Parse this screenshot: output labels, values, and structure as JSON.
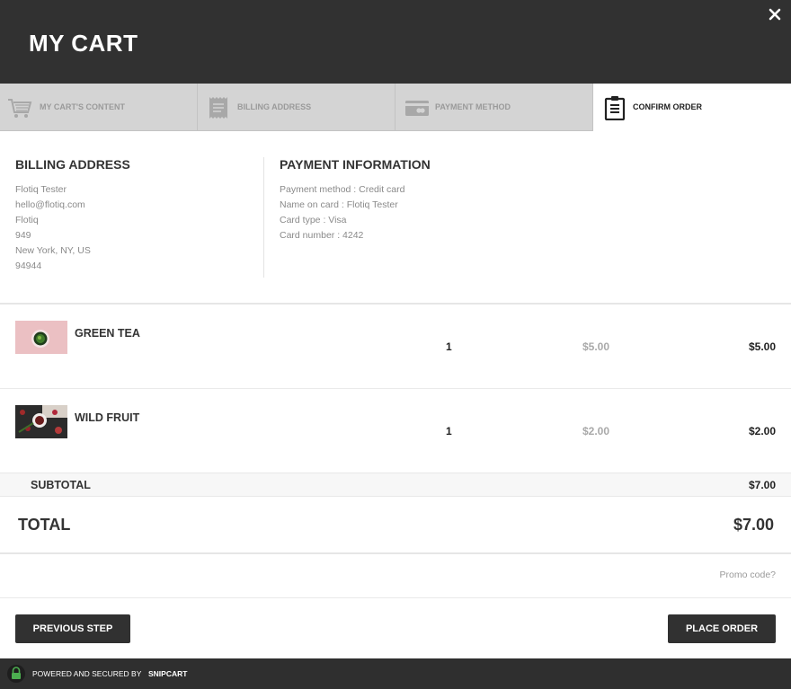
{
  "header": {
    "title": "MY CART",
    "close_icon": "close-icon"
  },
  "steps": [
    {
      "label": "MY CART'S CONTENT",
      "icon": "cart-icon",
      "active": false
    },
    {
      "label": "BILLING ADDRESS",
      "icon": "receipt-icon",
      "active": false
    },
    {
      "label": "PAYMENT METHOD",
      "icon": "credit-card-icon",
      "active": false
    },
    {
      "label": "CONFIRM ORDER",
      "icon": "clipboard-icon",
      "active": true
    }
  ],
  "billing": {
    "heading": "BILLING ADDRESS",
    "lines": [
      "Flotiq Tester",
      "hello@flotiq.com",
      "Flotiq",
      "949",
      "New York, NY, US",
      "94944"
    ]
  },
  "payment": {
    "heading": "PAYMENT INFORMATION",
    "lines": [
      "Payment method : Credit card",
      "Name on card : Flotiq Tester",
      "Card type : Visa",
      "Card number : 4242"
    ]
  },
  "items": [
    {
      "name": "GREEN TEA",
      "quantity": "1",
      "unit_price": "$5.00",
      "total": "$5.00"
    },
    {
      "name": "WILD FRUIT",
      "quantity": "1",
      "unit_price": "$2.00",
      "total": "$2.00"
    }
  ],
  "subtotal": {
    "label": "SUBTOTAL",
    "value": "$7.00"
  },
  "total": {
    "label": "TOTAL",
    "value": "$7.00"
  },
  "promo": {
    "label": "Promo code?"
  },
  "buttons": {
    "previous": "PREVIOUS STEP",
    "place_order": "PLACE ORDER"
  },
  "footer": {
    "text": "POWERED AND SECURED BY",
    "brand": "SNIPCART"
  },
  "colors": {
    "header_bg": "#313131",
    "step_bg": "#d4d4d4",
    "button_bg": "#313131",
    "lock_green": "#4caf50"
  }
}
